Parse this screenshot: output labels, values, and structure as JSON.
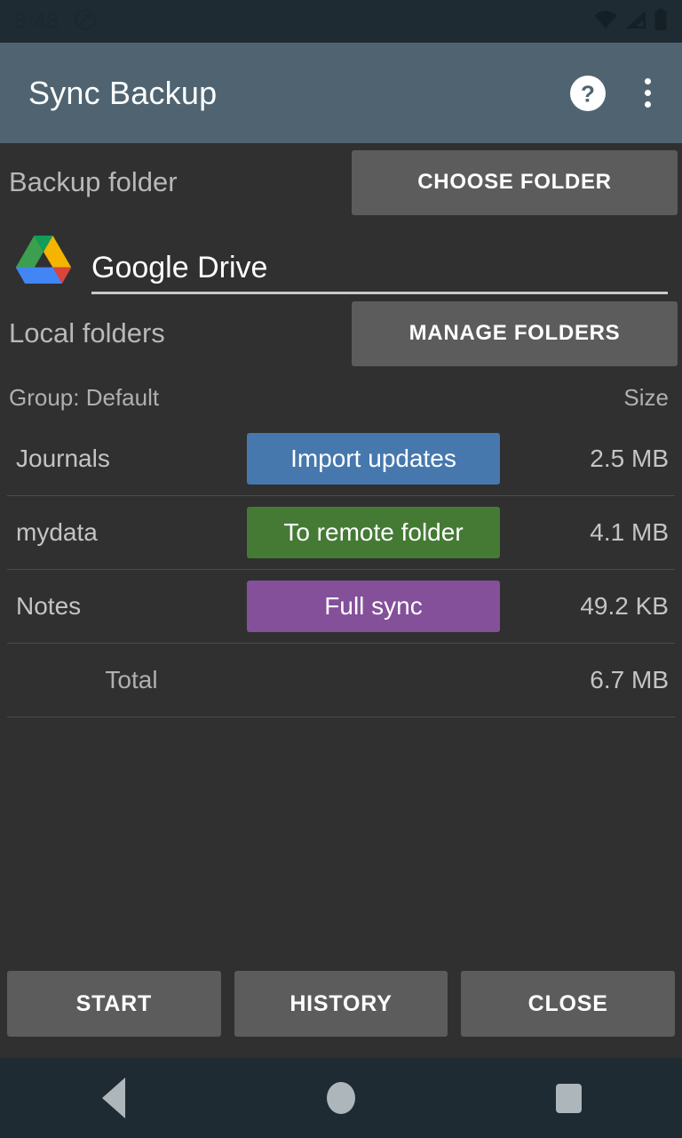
{
  "status_bar": {
    "clock": "8:48",
    "icons": [
      "do-not-disturb-icon",
      "wifi-icon",
      "cell-signal-icon",
      "battery-icon"
    ]
  },
  "action_bar": {
    "title": "Sync Backup",
    "help_icon": "help-circle-icon",
    "overflow_icon": "overflow-menu-icon"
  },
  "backup_folder": {
    "label": "Backup folder",
    "choose_button": "CHOOSE FOLDER",
    "account_icon": "google-drive-icon",
    "account_name": "Google Drive"
  },
  "local_folders": {
    "label": "Local folders",
    "manage_button": "MANAGE FOLDERS",
    "group_label": "Group: Default",
    "size_column": "Size",
    "rows": [
      {
        "name": "Journals",
        "mode": "Import updates",
        "mode_color": "#4678ad",
        "size": "2.5 MB"
      },
      {
        "name": "mydata",
        "mode": "To remote folder",
        "mode_color": "#457a35",
        "size": "4.1 MB"
      },
      {
        "name": "Notes",
        "mode": "Full sync",
        "mode_color": "#84509a",
        "size": "49.2 KB"
      }
    ],
    "total": {
      "label": "Total",
      "size": "6.7 MB"
    }
  },
  "bottom_actions": {
    "start": "START",
    "history": "HISTORY",
    "close": "CLOSE"
  },
  "nav_bar": {
    "back": "back-icon",
    "home": "home-icon",
    "recents": "recents-icon"
  },
  "colors": {
    "action_bar": "#4f6470",
    "status_bar": "#1f2b33",
    "background": "#303030",
    "button_grey": "#5c5c5c",
    "divider": "#4a4a4a"
  }
}
